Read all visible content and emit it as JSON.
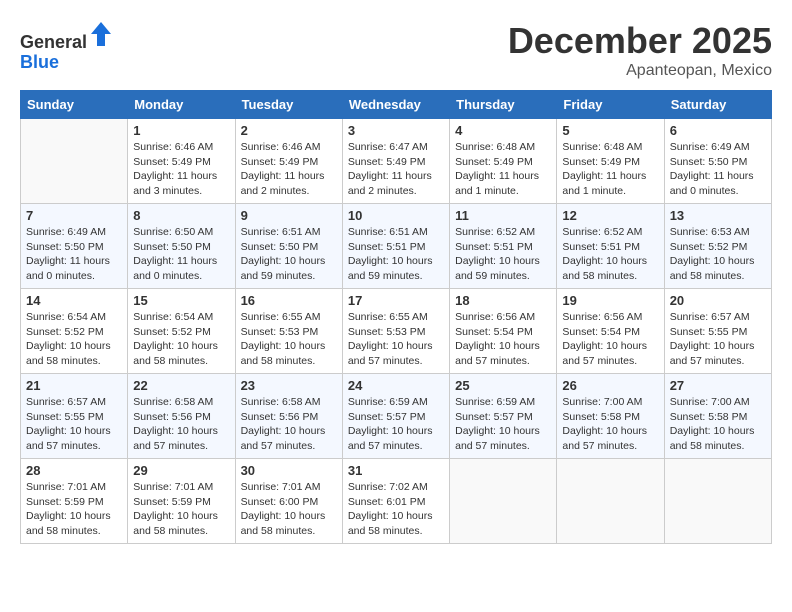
{
  "header": {
    "logo_line1": "General",
    "logo_line2": "Blue",
    "month": "December 2025",
    "location": "Apanteopan, Mexico"
  },
  "days_of_week": [
    "Sunday",
    "Monday",
    "Tuesday",
    "Wednesday",
    "Thursday",
    "Friday",
    "Saturday"
  ],
  "weeks": [
    [
      {
        "day": "",
        "sunrise": "",
        "sunset": "",
        "daylight": ""
      },
      {
        "day": "1",
        "sunrise": "Sunrise: 6:46 AM",
        "sunset": "Sunset: 5:49 PM",
        "daylight": "Daylight: 11 hours and 3 minutes."
      },
      {
        "day": "2",
        "sunrise": "Sunrise: 6:46 AM",
        "sunset": "Sunset: 5:49 PM",
        "daylight": "Daylight: 11 hours and 2 minutes."
      },
      {
        "day": "3",
        "sunrise": "Sunrise: 6:47 AM",
        "sunset": "Sunset: 5:49 PM",
        "daylight": "Daylight: 11 hours and 2 minutes."
      },
      {
        "day": "4",
        "sunrise": "Sunrise: 6:48 AM",
        "sunset": "Sunset: 5:49 PM",
        "daylight": "Daylight: 11 hours and 1 minute."
      },
      {
        "day": "5",
        "sunrise": "Sunrise: 6:48 AM",
        "sunset": "Sunset: 5:49 PM",
        "daylight": "Daylight: 11 hours and 1 minute."
      },
      {
        "day": "6",
        "sunrise": "Sunrise: 6:49 AM",
        "sunset": "Sunset: 5:50 PM",
        "daylight": "Daylight: 11 hours and 0 minutes."
      }
    ],
    [
      {
        "day": "7",
        "sunrise": "Sunrise: 6:49 AM",
        "sunset": "Sunset: 5:50 PM",
        "daylight": "Daylight: 11 hours and 0 minutes."
      },
      {
        "day": "8",
        "sunrise": "Sunrise: 6:50 AM",
        "sunset": "Sunset: 5:50 PM",
        "daylight": "Daylight: 11 hours and 0 minutes."
      },
      {
        "day": "9",
        "sunrise": "Sunrise: 6:51 AM",
        "sunset": "Sunset: 5:50 PM",
        "daylight": "Daylight: 10 hours and 59 minutes."
      },
      {
        "day": "10",
        "sunrise": "Sunrise: 6:51 AM",
        "sunset": "Sunset: 5:51 PM",
        "daylight": "Daylight: 10 hours and 59 minutes."
      },
      {
        "day": "11",
        "sunrise": "Sunrise: 6:52 AM",
        "sunset": "Sunset: 5:51 PM",
        "daylight": "Daylight: 10 hours and 59 minutes."
      },
      {
        "day": "12",
        "sunrise": "Sunrise: 6:52 AM",
        "sunset": "Sunset: 5:51 PM",
        "daylight": "Daylight: 10 hours and 58 minutes."
      },
      {
        "day": "13",
        "sunrise": "Sunrise: 6:53 AM",
        "sunset": "Sunset: 5:52 PM",
        "daylight": "Daylight: 10 hours and 58 minutes."
      }
    ],
    [
      {
        "day": "14",
        "sunrise": "Sunrise: 6:54 AM",
        "sunset": "Sunset: 5:52 PM",
        "daylight": "Daylight: 10 hours and 58 minutes."
      },
      {
        "day": "15",
        "sunrise": "Sunrise: 6:54 AM",
        "sunset": "Sunset: 5:52 PM",
        "daylight": "Daylight: 10 hours and 58 minutes."
      },
      {
        "day": "16",
        "sunrise": "Sunrise: 6:55 AM",
        "sunset": "Sunset: 5:53 PM",
        "daylight": "Daylight: 10 hours and 58 minutes."
      },
      {
        "day": "17",
        "sunrise": "Sunrise: 6:55 AM",
        "sunset": "Sunset: 5:53 PM",
        "daylight": "Daylight: 10 hours and 57 minutes."
      },
      {
        "day": "18",
        "sunrise": "Sunrise: 6:56 AM",
        "sunset": "Sunset: 5:54 PM",
        "daylight": "Daylight: 10 hours and 57 minutes."
      },
      {
        "day": "19",
        "sunrise": "Sunrise: 6:56 AM",
        "sunset": "Sunset: 5:54 PM",
        "daylight": "Daylight: 10 hours and 57 minutes."
      },
      {
        "day": "20",
        "sunrise": "Sunrise: 6:57 AM",
        "sunset": "Sunset: 5:55 PM",
        "daylight": "Daylight: 10 hours and 57 minutes."
      }
    ],
    [
      {
        "day": "21",
        "sunrise": "Sunrise: 6:57 AM",
        "sunset": "Sunset: 5:55 PM",
        "daylight": "Daylight: 10 hours and 57 minutes."
      },
      {
        "day": "22",
        "sunrise": "Sunrise: 6:58 AM",
        "sunset": "Sunset: 5:56 PM",
        "daylight": "Daylight: 10 hours and 57 minutes."
      },
      {
        "day": "23",
        "sunrise": "Sunrise: 6:58 AM",
        "sunset": "Sunset: 5:56 PM",
        "daylight": "Daylight: 10 hours and 57 minutes."
      },
      {
        "day": "24",
        "sunrise": "Sunrise: 6:59 AM",
        "sunset": "Sunset: 5:57 PM",
        "daylight": "Daylight: 10 hours and 57 minutes."
      },
      {
        "day": "25",
        "sunrise": "Sunrise: 6:59 AM",
        "sunset": "Sunset: 5:57 PM",
        "daylight": "Daylight: 10 hours and 57 minutes."
      },
      {
        "day": "26",
        "sunrise": "Sunrise: 7:00 AM",
        "sunset": "Sunset: 5:58 PM",
        "daylight": "Daylight: 10 hours and 57 minutes."
      },
      {
        "day": "27",
        "sunrise": "Sunrise: 7:00 AM",
        "sunset": "Sunset: 5:58 PM",
        "daylight": "Daylight: 10 hours and 58 minutes."
      }
    ],
    [
      {
        "day": "28",
        "sunrise": "Sunrise: 7:01 AM",
        "sunset": "Sunset: 5:59 PM",
        "daylight": "Daylight: 10 hours and 58 minutes."
      },
      {
        "day": "29",
        "sunrise": "Sunrise: 7:01 AM",
        "sunset": "Sunset: 5:59 PM",
        "daylight": "Daylight: 10 hours and 58 minutes."
      },
      {
        "day": "30",
        "sunrise": "Sunrise: 7:01 AM",
        "sunset": "Sunset: 6:00 PM",
        "daylight": "Daylight: 10 hours and 58 minutes."
      },
      {
        "day": "31",
        "sunrise": "Sunrise: 7:02 AM",
        "sunset": "Sunset: 6:01 PM",
        "daylight": "Daylight: 10 hours and 58 minutes."
      },
      {
        "day": "",
        "sunrise": "",
        "sunset": "",
        "daylight": ""
      },
      {
        "day": "",
        "sunrise": "",
        "sunset": "",
        "daylight": ""
      },
      {
        "day": "",
        "sunrise": "",
        "sunset": "",
        "daylight": ""
      }
    ]
  ]
}
